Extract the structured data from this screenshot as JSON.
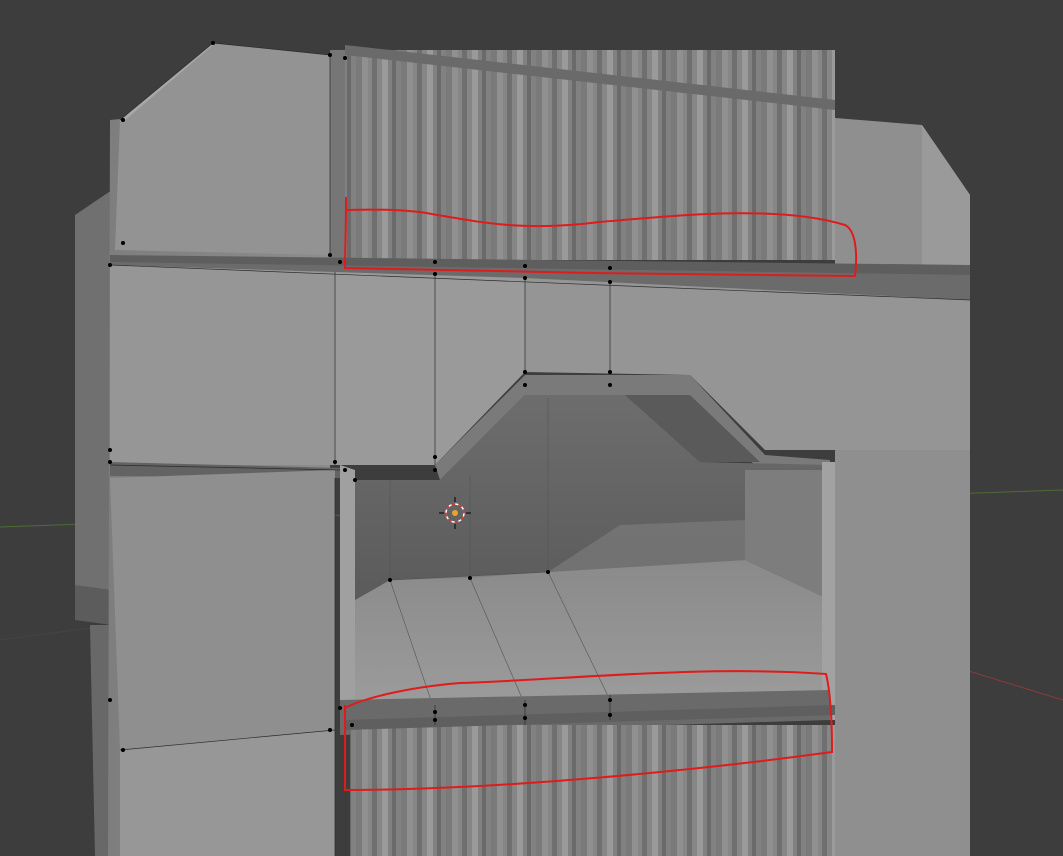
{
  "viewport": {
    "background_color": "#3d3d3d",
    "model_color": "#8c8c8c",
    "grid_x_axis_color": "#8a3b3b",
    "grid_y_axis_color": "#4e6b35",
    "annotation_color": "#e01b1b",
    "cursor_icon": "3d-cursor-icon"
  }
}
